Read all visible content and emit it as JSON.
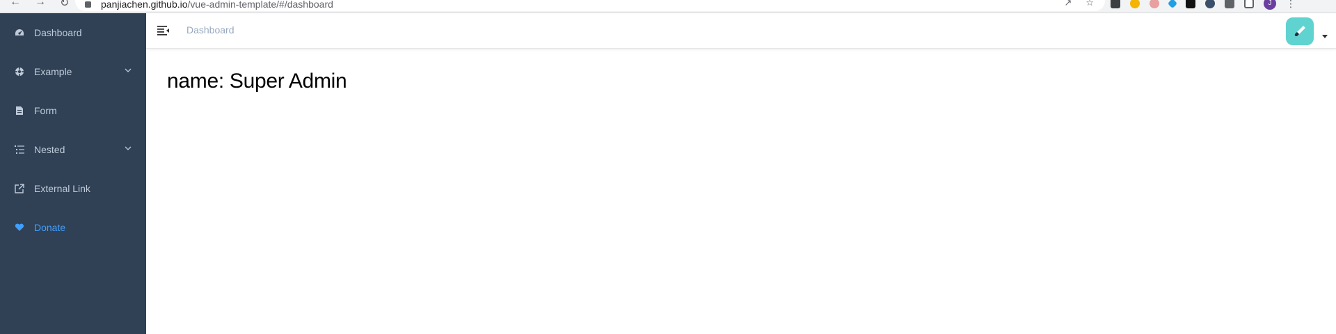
{
  "browser": {
    "url_host": "panjiachen.github.io",
    "url_path": "/vue-admin-template/#/dashboard"
  },
  "sidebar": {
    "background": "#304156",
    "text_color": "#bfcbd9",
    "active_color": "#409eff",
    "items": [
      {
        "label": "Dashboard",
        "icon": "dashboard-icon",
        "has_submenu": false,
        "active": false
      },
      {
        "label": "Example",
        "icon": "example-icon",
        "has_submenu": true,
        "active": false
      },
      {
        "label": "Form",
        "icon": "form-icon",
        "has_submenu": false,
        "active": false
      },
      {
        "label": "Nested",
        "icon": "nested-icon",
        "has_submenu": true,
        "active": false
      },
      {
        "label": "External Link",
        "icon": "external-link-icon",
        "has_submenu": false,
        "active": false
      },
      {
        "label": "Donate",
        "icon": "donate-icon",
        "has_submenu": false,
        "active": true
      }
    ]
  },
  "navbar": {
    "breadcrumb": "Dashboard",
    "hamburger_icon": "hamburger-icon",
    "avatar_icon": "avatar-icon",
    "avatar_color": "#5fd3d0"
  },
  "dashboard": {
    "name_text": "name: Super Admin"
  }
}
